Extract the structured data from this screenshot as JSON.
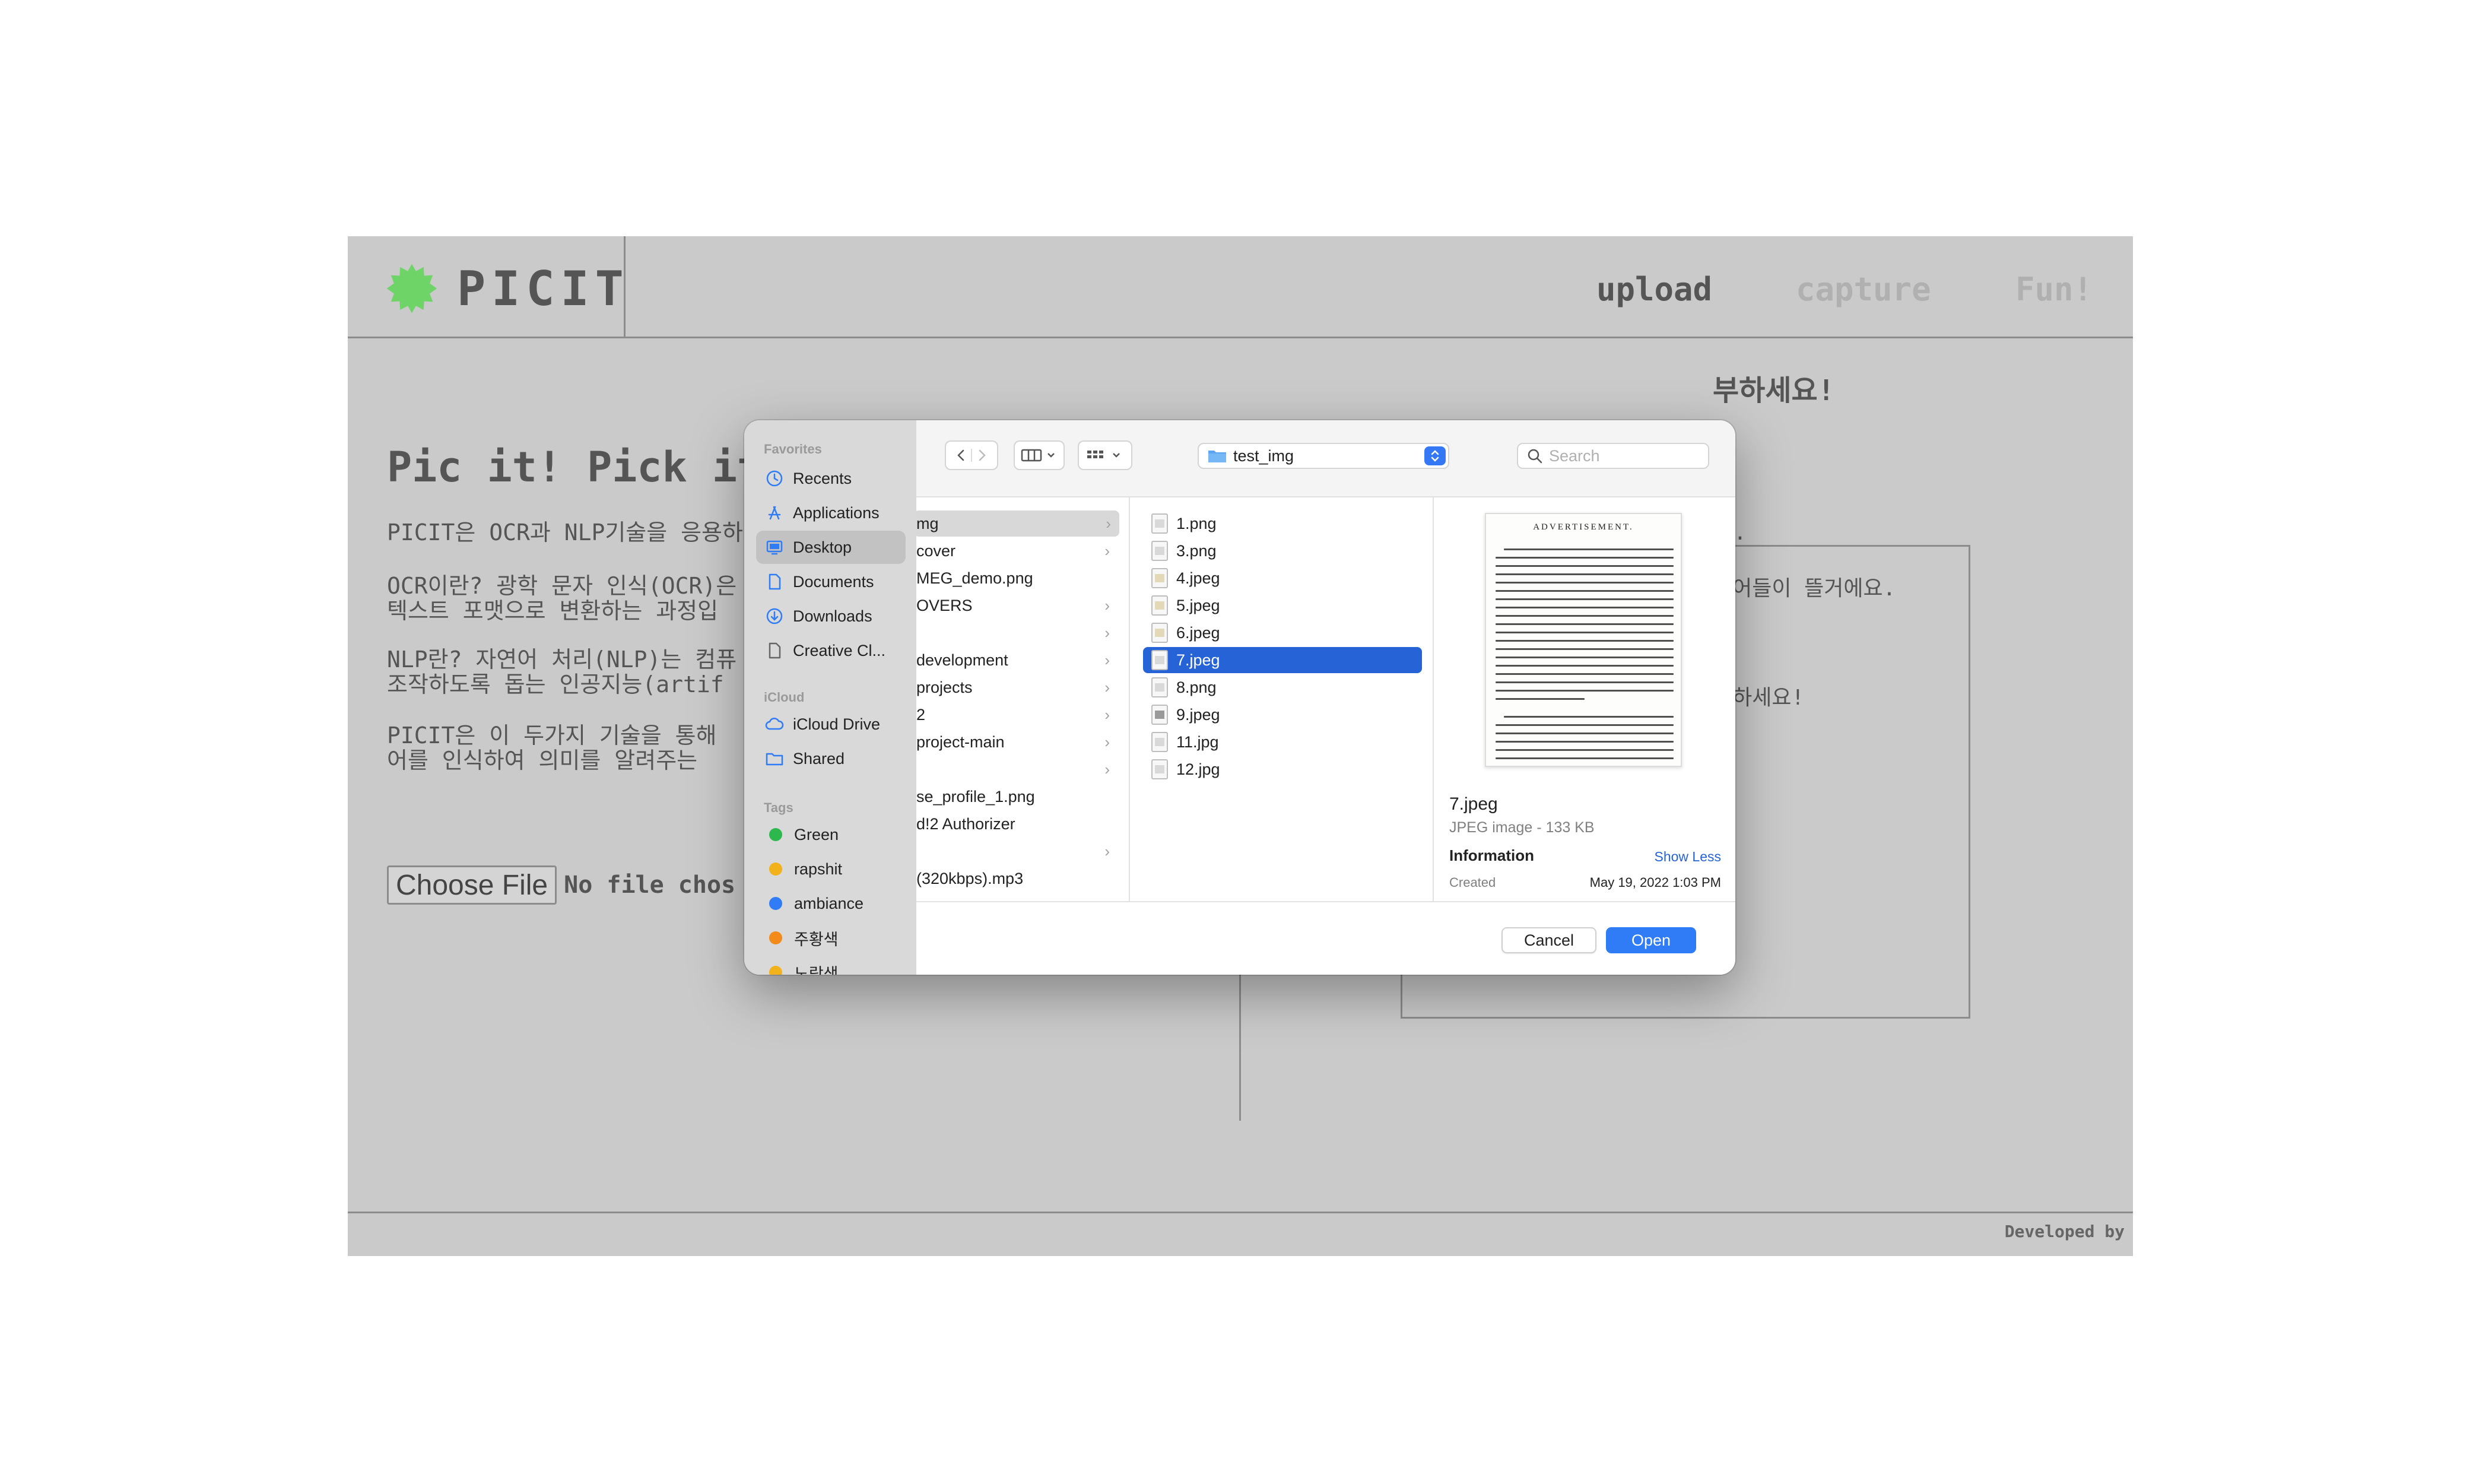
{
  "app": {
    "logo_text": "PICIT",
    "nav": {
      "upload": "upload",
      "capture": "capture",
      "fun": "Fun!"
    },
    "hero_title": "Pic it! Pick it",
    "paragraphs": [
      "PICIT은 OCR과 NLP기술을 응용하",
      "OCR이란? 광학 문자 인식(OCR)은\n텍스트 포맷으로 변환하는 과정입",
      "NLP란? 자연어 처리(NLP)는 컴퓨\n조작하도록 돕는 인공지능(artif",
      "PICIT은 이 두가지 기술을 통해\n어를 인식하여 의미를 알려주는"
    ],
    "file_input": {
      "button": "Choose File",
      "status": "No file chos"
    },
    "result_lines": [
      "부하세요!",
      "요.",
      "단어들이 뜰거에요.",
      "유하세요!"
    ],
    "footer": "Developed by",
    "accent_color": "#6fd467"
  },
  "dialog": {
    "sidebar": {
      "favorites_heading": "Favorites",
      "favorites": [
        {
          "label": "Recents",
          "icon": "clock-icon"
        },
        {
          "label": "Applications",
          "icon": "applications-icon"
        },
        {
          "label": "Desktop",
          "icon": "desktop-icon"
        },
        {
          "label": "Documents",
          "icon": "document-icon"
        },
        {
          "label": "Downloads",
          "icon": "download-icon"
        },
        {
          "label": "Creative Cl...",
          "icon": "file-icon"
        }
      ],
      "icloud_heading": "iCloud",
      "icloud": [
        {
          "label": "iCloud Drive",
          "icon": "cloud-icon"
        },
        {
          "label": "Shared",
          "icon": "shared-folder-icon"
        }
      ],
      "tags_heading": "Tags",
      "tags": [
        {
          "label": "Green",
          "color": "#2db84d"
        },
        {
          "label": "rapshit",
          "color": "#f2b21c"
        },
        {
          "label": "ambiance",
          "color": "#2f7cf6"
        },
        {
          "label": "주황색",
          "color": "#f28a1c"
        },
        {
          "label": "노랑색",
          "color": "#f2b21c"
        }
      ]
    },
    "toolbar": {
      "folder": "test_img",
      "search_placeholder": "Search"
    },
    "column1": [
      "mg",
      "cover",
      "MEG_demo.png",
      "OVERS",
      "",
      "development",
      "projects",
      "2",
      "project-main",
      "",
      "se_profile_1.png",
      "d!2 Authorizer",
      "",
      " (320kbps).mp3"
    ],
    "files": [
      "1.png",
      "3.png",
      "4.jpeg",
      "5.jpeg",
      "6.jpeg",
      "7.jpeg",
      "8.png",
      "9.jpeg",
      "11.jpg",
      "12.jpg"
    ],
    "selected_file": "7.jpeg",
    "preview": {
      "thumb_heading": "ADVERTISEMENT.",
      "name": "7.jpeg",
      "kind": "JPEG image - 133 KB",
      "info_heading": "Information",
      "show_less": "Show Less",
      "created_label": "Created",
      "created_value": "May 19, 2022 1:03 PM"
    },
    "buttons": {
      "cancel": "Cancel",
      "open": "Open"
    }
  }
}
